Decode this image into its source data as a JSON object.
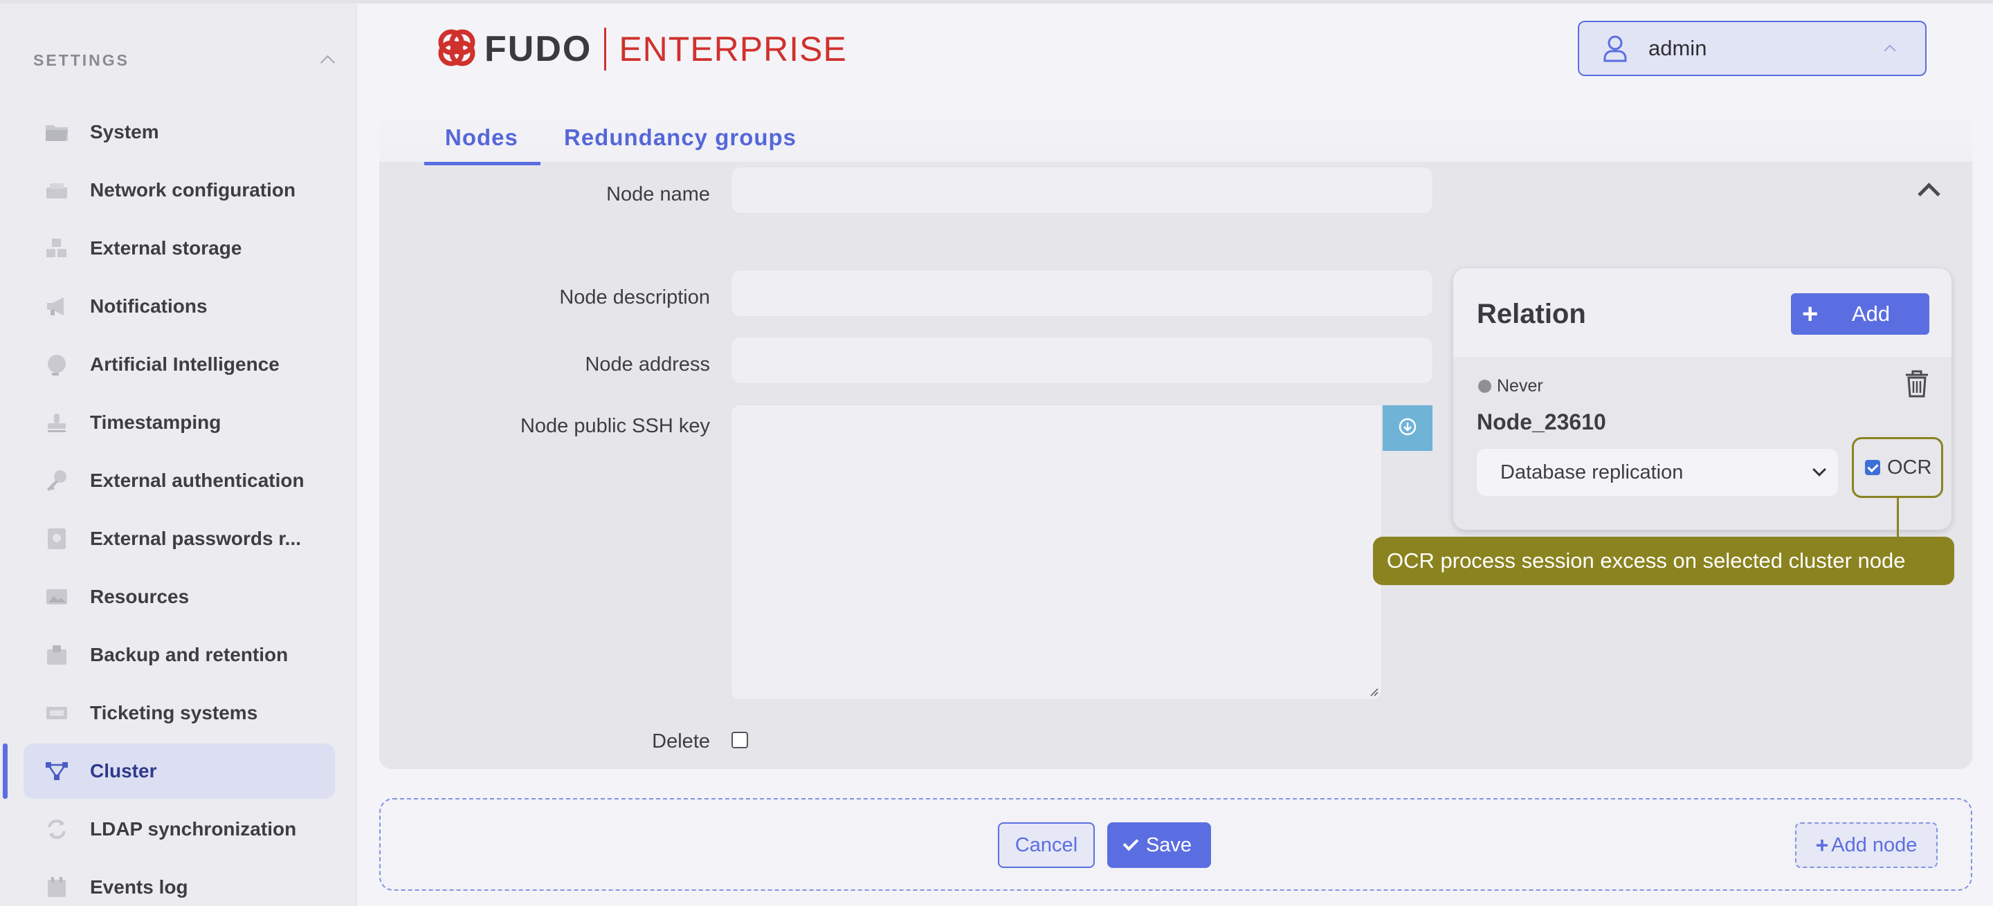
{
  "sidebar": {
    "section_title": "SETTINGS",
    "items": [
      {
        "label": "System",
        "icon": "folder-icon"
      },
      {
        "label": "Network configuration",
        "icon": "network-icon"
      },
      {
        "label": "External storage",
        "icon": "storage-icon"
      },
      {
        "label": "Notifications",
        "icon": "megaphone-icon"
      },
      {
        "label": "Artificial Intelligence",
        "icon": "brain-icon"
      },
      {
        "label": "Timestamping",
        "icon": "stamp-icon"
      },
      {
        "label": "External authentication",
        "icon": "key-icon"
      },
      {
        "label": "External passwords r...",
        "icon": "password-vault-icon"
      },
      {
        "label": "Resources",
        "icon": "image-icon"
      },
      {
        "label": "Backup and retention",
        "icon": "backup-icon"
      },
      {
        "label": "Ticketing systems",
        "icon": "ticket-icon"
      },
      {
        "label": "Cluster",
        "icon": "cluster-icon",
        "active": true
      },
      {
        "label": "LDAP synchronization",
        "icon": "sync-icon"
      },
      {
        "label": "Events log",
        "icon": "calendar-icon"
      }
    ]
  },
  "header": {
    "logo_brand": "FUDO",
    "logo_edition": "ENTERPRISE",
    "user": "admin"
  },
  "tabs": [
    {
      "label": "Nodes",
      "active": true
    },
    {
      "label": "Redundancy groups",
      "active": false
    }
  ],
  "form": {
    "node_name_label": "Node name",
    "node_name_value": "",
    "node_description_label": "Node description",
    "node_description_value": "",
    "node_address_label": "Node address",
    "node_address_value": "",
    "ssh_key_label": "Node public SSH key",
    "ssh_key_value": "",
    "delete_label": "Delete",
    "delete_checked": false
  },
  "relation": {
    "title": "Relation",
    "add_label": "Add",
    "status": "Never",
    "node": "Node_23610",
    "type_selected": "Database replication",
    "ocr_label": "OCR",
    "ocr_checked": true,
    "callout": "OCR process session excess on selected cluster node"
  },
  "footer": {
    "cancel_label": "Cancel",
    "save_label": "Save",
    "add_node_label": "Add node"
  },
  "colors": {
    "accent": "#5b6ee1",
    "brand_red": "#d0312d",
    "callout_olive": "#8a8320",
    "download_blue": "#6fb3d6"
  }
}
